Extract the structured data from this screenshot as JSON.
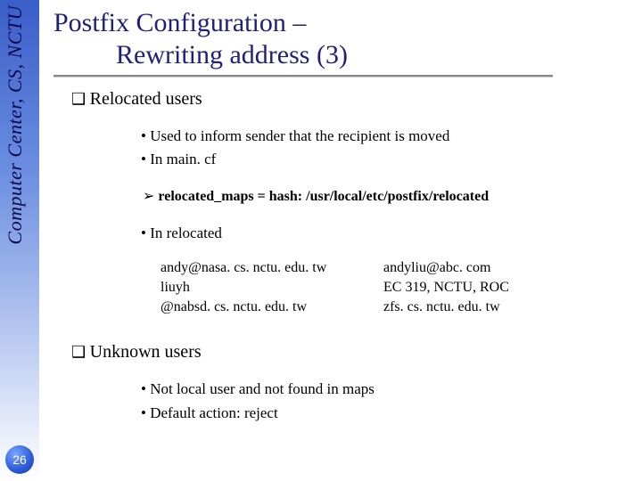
{
  "sidebar": {
    "label": "Computer Center, CS, NCTU"
  },
  "page_number": "26",
  "title": {
    "line1": "Postfix Configuration –",
    "line2": "Rewriting address (3)"
  },
  "sections": {
    "relocated": {
      "heading": "Relocated users",
      "bullets": {
        "b1": "Used to inform sender that the recipient is moved",
        "b2": "In main. cf",
        "b3": "In relocated"
      },
      "config_line": "relocated_maps = hash: /usr/local/etc/postfix/relocated",
      "mappings": [
        {
          "from": "andy@nasa. cs. nctu. edu. tw",
          "to": "andyliu@abc. com"
        },
        {
          "from": "liuyh",
          "to": "EC 319, NCTU, ROC"
        },
        {
          "from": "@nabsd. cs. nctu. edu. tw",
          "to": "zfs. cs. nctu. edu. tw"
        }
      ]
    },
    "unknown": {
      "heading": "Unknown users",
      "bullets": {
        "b1": "Not local user and not found in maps",
        "b2": "Default action: reject"
      }
    }
  }
}
